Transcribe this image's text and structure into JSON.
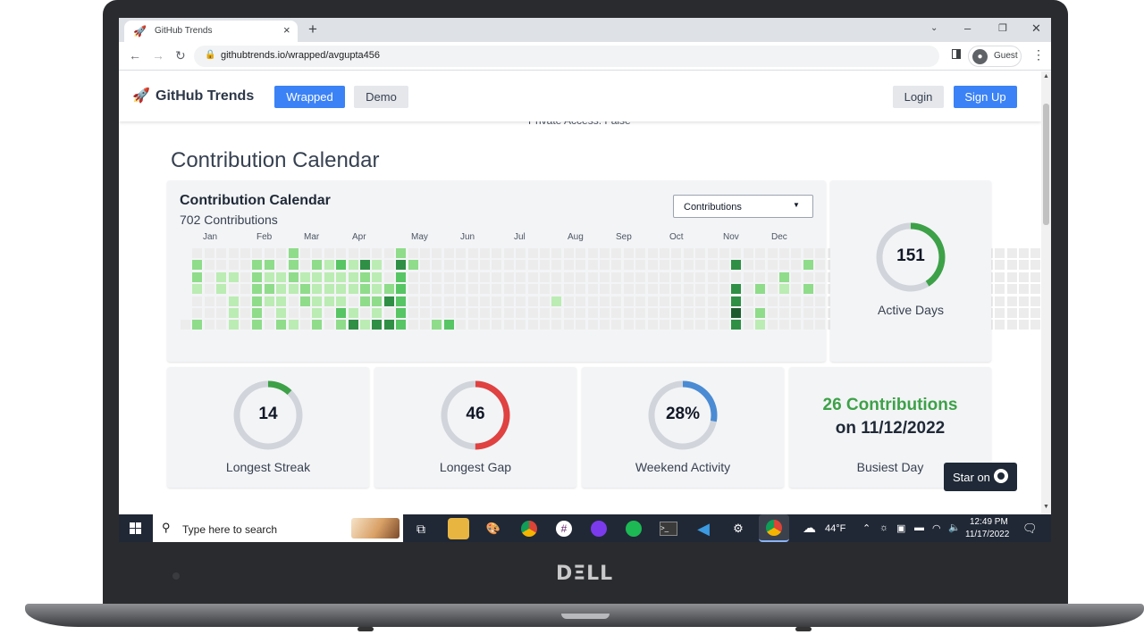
{
  "browser": {
    "tab_title": "GitHub Trends",
    "tab_icon": "rocket-icon",
    "url": "githubtrends.io/wrapped/avgupta456",
    "profile_label": "Guest"
  },
  "navbar": {
    "brand": "GitHub Trends",
    "wrapped_label": "Wrapped",
    "demo_label": "Demo",
    "login_label": "Login",
    "signup_label": "Sign Up"
  },
  "partial_text_top": "Private Access: False",
  "section_title": "Contribution Calendar",
  "calendar": {
    "title": "Contribution Calendar",
    "subtitle": "702 Contributions",
    "dropdown_value": "Contributions",
    "months": [
      "Jan",
      "Feb",
      "Mar",
      "Apr",
      "May",
      "Jun",
      "Jul",
      "Aug",
      "Sep",
      "Oct",
      "Nov",
      "Dec"
    ],
    "colors": [
      "#ececec",
      "#bbecb3",
      "#8fdc8a",
      "#57c563",
      "#2f8f45",
      "#1e5c30"
    ],
    "levels": [
      "0001000",
      "0221002",
      "0000000",
      "0011000",
      "0010111",
      "0000000",
      "0222222",
      "0212100",
      "0011112",
      "2221001",
      "0012200",
      "0211112",
      "0111100",
      "0311132",
      "0111014",
      "0422201",
      "0111214",
      "0002404",
      "2433333",
      "0200000",
      "0000000",
      "0000002",
      "0000003",
      "0000000",
      "0000000",
      "0000000",
      "0000000",
      "0000000",
      "0000000",
      "0000000",
      "0000000",
      "0000100",
      "0000000",
      "0000000",
      "0000000",
      "0000000",
      "0000000",
      "0000000",
      "0000000",
      "0000000",
      "0000000",
      "0000000",
      "0000000",
      "0000000",
      "0000000",
      "0000000",
      "0404454",
      "0000000",
      "0002021",
      "0000000",
      "0021000",
      "0000000",
      "0202000",
      "0000000",
      "0000000",
      "0101020",
      "0202000",
      "0123310",
      "0111100",
      "0101000",
      "0005111",
      "0202000",
      "0101010",
      "0504030",
      "0000000",
      "0000000",
      "0000000",
      "0000000",
      "0000000",
      "0000000",
      "0000000",
      "0000000",
      "0000000",
      "0000000"
    ]
  },
  "stats": {
    "active_days": {
      "value": "151",
      "label": "Active Days",
      "fraction": 0.41,
      "color": "#3da148"
    },
    "longest_streak": {
      "value": "14",
      "label": "Longest Streak",
      "fraction": 0.12,
      "color": "#3da148"
    },
    "longest_gap": {
      "value": "46",
      "label": "Longest Gap",
      "fraction": 0.5,
      "color": "#e04141"
    },
    "weekend_activity": {
      "value": "28%",
      "label": "Weekend Activity",
      "fraction": 0.28,
      "color": "#4a8bd4"
    },
    "busiest_day": {
      "line1": "26 Contributions",
      "line2": "on 11/12/2022",
      "label": "Busiest Day",
      "color": "#3da148"
    }
  },
  "ring_track_color": "#d1d5db",
  "star_button": {
    "label": "Star on"
  },
  "taskbar": {
    "search_placeholder": "Type here to search",
    "weather": "44°F",
    "time": "12:49 PM",
    "date": "11/17/2022"
  }
}
